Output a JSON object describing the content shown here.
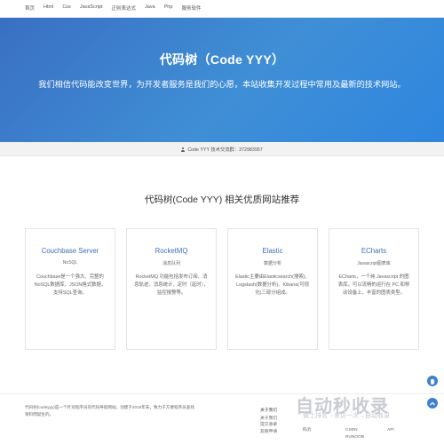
{
  "nav": {
    "items": [
      "首页",
      "Html",
      "Css",
      "JavaScript",
      "正则表达式",
      "Java",
      "Php",
      "服务软件"
    ]
  },
  "hero": {
    "title": "代码树（Code YYY）",
    "subtitle": "我们相信代码能改变世界，为开发者服务是我们的心愿，本站收集开发过程中常用及最新的技术网站。"
  },
  "strip": {
    "text": "Code YYY 技术交流群：372983957"
  },
  "section": {
    "title": "代码树(Code YYY) 相关优质网站推荐"
  },
  "cards": [
    {
      "name": "Couchbase Server",
      "type": "NoSQL",
      "desc": "Couchbase是一个强大、完整的NoSQL数据库，JSON格式数据，支持SQL查询。"
    },
    {
      "name": "RocketMQ",
      "type": "消息队列",
      "desc": "RocketMQ 功能包括发布订阅、消息轨迹、消息统计、定时（延时），监控报警等。"
    },
    {
      "name": "Elastic",
      "type": "数据分析",
      "desc": "Elastic主要由Elasticsearch(搜索)、Logstash(数据分析)、Kibana(可视化)三部分组成。"
    },
    {
      "name": "ECharts",
      "type": "Javascript图表库",
      "desc": "ECharts，一个纯 Javascript 的图表库，可以流畅的运行在 PC 和移动设备上，丰富的图表类型。"
    }
  ],
  "footer": {
    "about": "代码树(codeyyy)是一个针对程序员的代码导航网站，创建于2016年末，致力于方便程序员查找资料而诞生的。",
    "col1": {
      "head": "关于我们",
      "links": [
        "关于我们",
        "提交收录",
        "友链申请"
      ]
    },
    "col2": {
      "links": [
        "码云"
      ]
    },
    "col3": {
      "links": [
        "CSDN",
        "RUNOOB"
      ]
    },
    "col4": {
      "links": [
        "API"
      ]
    }
  },
  "watermark": {
    "logo": "自动秒收录",
    "tagline": "做上排名→来访一次→自动收录"
  },
  "colors": {
    "hero_start": "#3a6fc2",
    "hero_end": "#2f86df",
    "card_title": "#3e6fb6",
    "side_button": "#3d7fd3"
  }
}
